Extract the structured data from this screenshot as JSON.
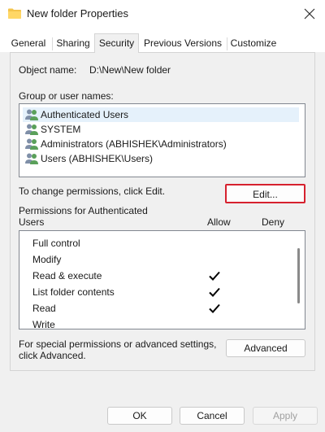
{
  "window": {
    "title": "New folder Properties"
  },
  "tabs": [
    "General",
    "Sharing",
    "Security",
    "Previous Versions",
    "Customize"
  ],
  "active_tab": "Security",
  "object": {
    "label": "Object name:",
    "value": "D:\\New\\New folder"
  },
  "groups": {
    "label": "Group or user names:",
    "items": [
      "Authenticated Users",
      "SYSTEM",
      "Administrators (ABHISHEK\\Administrators)",
      "Users (ABHISHEK\\Users)"
    ],
    "selected_index": 0
  },
  "change_hint": "To change permissions, click Edit.",
  "edit_label": "Edit...",
  "permissions": {
    "header_line1": "Permissions for Authenticated",
    "header_line2": "Users",
    "allow_label": "Allow",
    "deny_label": "Deny",
    "rows": [
      {
        "label": "Full control",
        "allow": false,
        "deny": false
      },
      {
        "label": "Modify",
        "allow": false,
        "deny": false
      },
      {
        "label": "Read & execute",
        "allow": true,
        "deny": false
      },
      {
        "label": "List folder contents",
        "allow": true,
        "deny": false
      },
      {
        "label": "Read",
        "allow": true,
        "deny": false
      },
      {
        "label": "Write",
        "allow": false,
        "deny": false
      }
    ]
  },
  "special": {
    "line1": "For special permissions or advanced settings,",
    "line2": "click Advanced.",
    "advanced_label": "Advanced"
  },
  "footer": {
    "ok_label": "OK",
    "cancel_label": "Cancel",
    "apply_label": "Apply"
  },
  "colors": {
    "edit_highlight": "#d6212e",
    "folder": "#f4c44b",
    "selection": "#e5f1fb"
  }
}
